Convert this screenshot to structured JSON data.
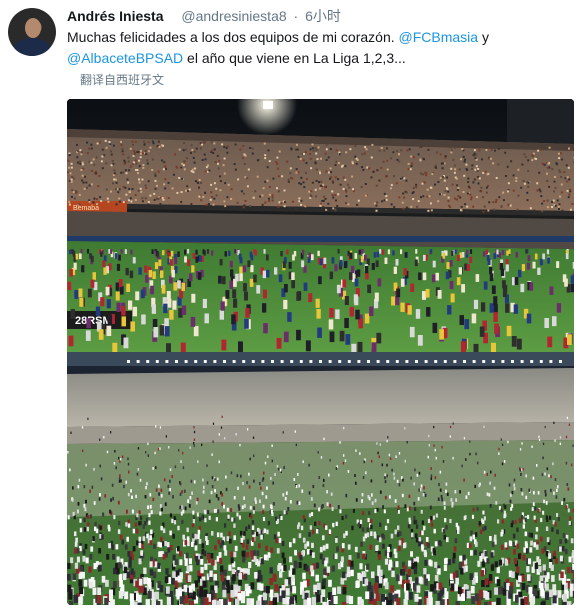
{
  "tweet": {
    "author_name": "Andrés Iniesta",
    "handle": "@andresiniesta8",
    "separator": "·",
    "time": "6小时",
    "text_part1": "Muchas felicidades a los dos equipos de mi corazón. ",
    "mention1": "@FCBmasia",
    "text_part2": " y ",
    "mention2": "@AlbaceteBPSAD",
    "text_part3": " el año que viene en La Liga 1,2,3...",
    "translate_label": "翻译自西班牙文"
  },
  "photos": {
    "top_banner_text": "28RSM",
    "top_board_text": "Bemaba"
  },
  "colors": {
    "link": "#1b95e0",
    "secondary_text": "#657786",
    "pitch_green": "#4f8f3a"
  }
}
